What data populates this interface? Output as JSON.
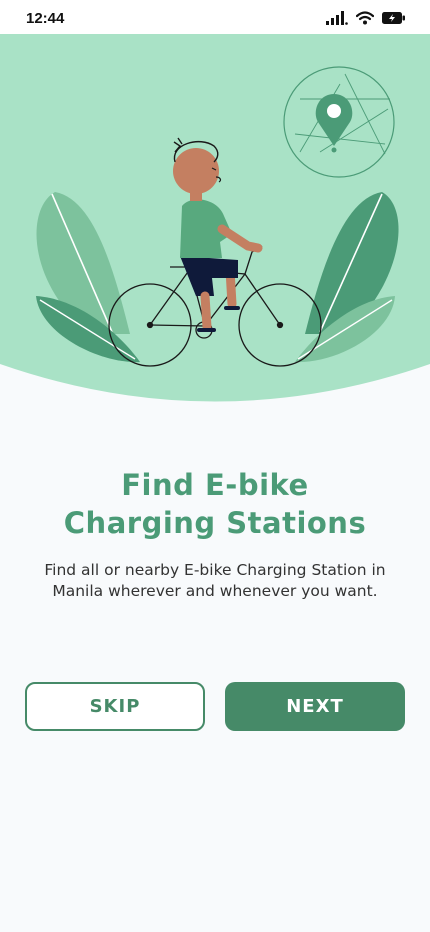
{
  "status_bar": {
    "time": "12:44",
    "icons": [
      "signal-icon",
      "wifi-icon",
      "battery-charging-icon"
    ]
  },
  "onboarding": {
    "title_line1": "Find E-bike",
    "title_line2": "Charging Stations",
    "description": "Find all or nearby E-bike Charging Station in Manila wherever and whenever you want."
  },
  "buttons": {
    "skip_label": "SKIP",
    "next_label": "NEXT"
  },
  "colors": {
    "accent": "#468a68",
    "title": "#4b9b77",
    "hero_bg": "#a9e2c6",
    "page_bg": "#f8fafc"
  }
}
